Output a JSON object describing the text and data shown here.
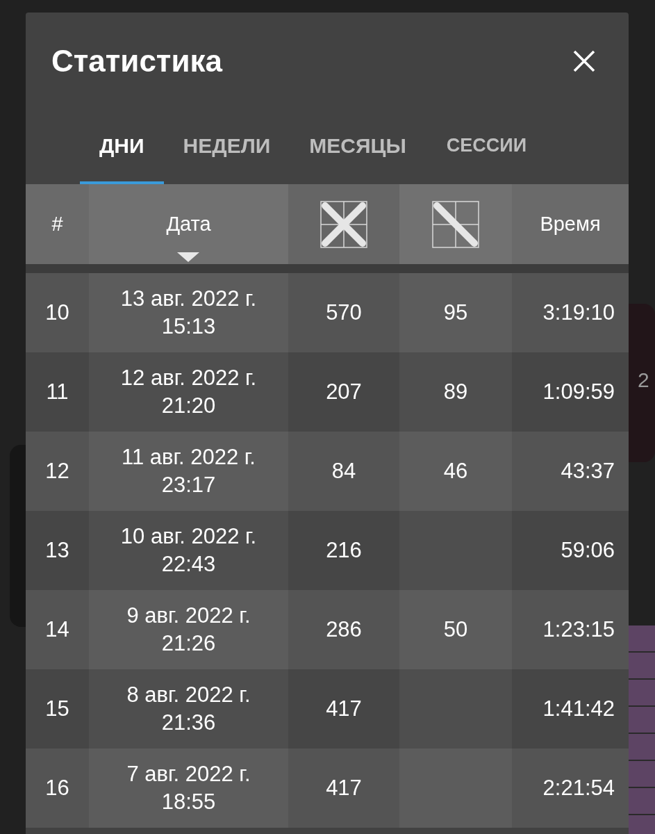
{
  "background": {
    "count": "2"
  },
  "dialog": {
    "title": "Статистика",
    "tabs": [
      {
        "label": "ДНИ",
        "selected": true
      },
      {
        "label": "НЕДЕЛИ",
        "selected": false
      },
      {
        "label": "МЕСЯЦЫ",
        "selected": false
      },
      {
        "label": "СЕССИИ",
        "selected": false
      }
    ],
    "table": {
      "columns": [
        {
          "kind": "text",
          "label": "#",
          "sorted": false
        },
        {
          "kind": "text",
          "label": "Дата",
          "sorted": true
        },
        {
          "kind": "cross",
          "sorted": false
        },
        {
          "kind": "diagonal",
          "sorted": false
        },
        {
          "kind": "text",
          "label": "Время",
          "sorted": false
        }
      ],
      "rows": [
        {
          "cells": [
            "10",
            "13 авг. 2022 г.\n15:13",
            "570",
            "95",
            "3:19:10"
          ]
        },
        {
          "cells": [
            "11",
            "12 авг. 2022 г.\n21:20",
            "207",
            "89",
            "1:09:59"
          ]
        },
        {
          "cells": [
            "12",
            "11 авг. 2022 г.\n23:17",
            "84",
            "46",
            "43:37"
          ]
        },
        {
          "cells": [
            "13",
            "10 авг. 2022 г.\n22:43",
            "216",
            null,
            "59:06"
          ]
        },
        {
          "cells": [
            "14",
            "9 авг. 2022 г.\n21:26",
            "286",
            "50",
            "1:23:15"
          ]
        },
        {
          "cells": [
            "15",
            "8 авг. 2022 г.\n21:36",
            "417",
            null,
            "1:41:42"
          ]
        },
        {
          "cells": [
            "16",
            "7 авг. 2022 г.\n18:55",
            "417",
            null,
            "2:21:54"
          ]
        }
      ]
    }
  }
}
